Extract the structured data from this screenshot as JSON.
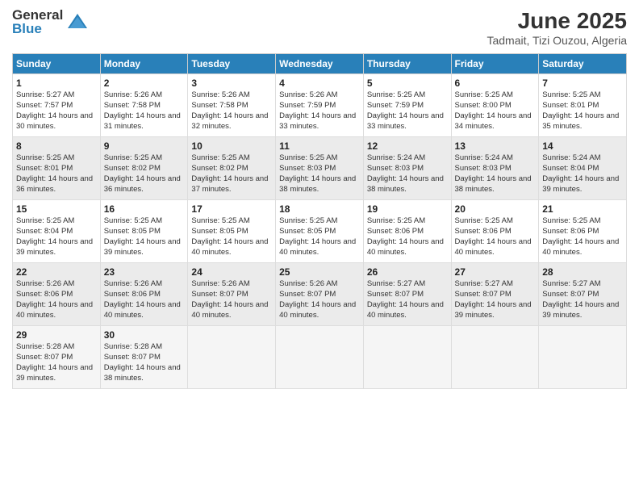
{
  "logo": {
    "general": "General",
    "blue": "Blue"
  },
  "title": "June 2025",
  "subtitle": "Tadmait, Tizi Ouzou, Algeria",
  "headers": [
    "Sunday",
    "Monday",
    "Tuesday",
    "Wednesday",
    "Thursday",
    "Friday",
    "Saturday"
  ],
  "weeks": [
    [
      {
        "num": "1",
        "sunrise": "5:27 AM",
        "sunset": "7:57 PM",
        "daylight": "14 hours and 30 minutes."
      },
      {
        "num": "2",
        "sunrise": "5:26 AM",
        "sunset": "7:58 PM",
        "daylight": "14 hours and 31 minutes."
      },
      {
        "num": "3",
        "sunrise": "5:26 AM",
        "sunset": "7:58 PM",
        "daylight": "14 hours and 32 minutes."
      },
      {
        "num": "4",
        "sunrise": "5:26 AM",
        "sunset": "7:59 PM",
        "daylight": "14 hours and 33 minutes."
      },
      {
        "num": "5",
        "sunrise": "5:25 AM",
        "sunset": "7:59 PM",
        "daylight": "14 hours and 33 minutes."
      },
      {
        "num": "6",
        "sunrise": "5:25 AM",
        "sunset": "8:00 PM",
        "daylight": "14 hours and 34 minutes."
      },
      {
        "num": "7",
        "sunrise": "5:25 AM",
        "sunset": "8:01 PM",
        "daylight": "14 hours and 35 minutes."
      }
    ],
    [
      {
        "num": "8",
        "sunrise": "5:25 AM",
        "sunset": "8:01 PM",
        "daylight": "14 hours and 36 minutes."
      },
      {
        "num": "9",
        "sunrise": "5:25 AM",
        "sunset": "8:02 PM",
        "daylight": "14 hours and 36 minutes."
      },
      {
        "num": "10",
        "sunrise": "5:25 AM",
        "sunset": "8:02 PM",
        "daylight": "14 hours and 37 minutes."
      },
      {
        "num": "11",
        "sunrise": "5:25 AM",
        "sunset": "8:03 PM",
        "daylight": "14 hours and 38 minutes."
      },
      {
        "num": "12",
        "sunrise": "5:24 AM",
        "sunset": "8:03 PM",
        "daylight": "14 hours and 38 minutes."
      },
      {
        "num": "13",
        "sunrise": "5:24 AM",
        "sunset": "8:03 PM",
        "daylight": "14 hours and 38 minutes."
      },
      {
        "num": "14",
        "sunrise": "5:24 AM",
        "sunset": "8:04 PM",
        "daylight": "14 hours and 39 minutes."
      }
    ],
    [
      {
        "num": "15",
        "sunrise": "5:25 AM",
        "sunset": "8:04 PM",
        "daylight": "14 hours and 39 minutes."
      },
      {
        "num": "16",
        "sunrise": "5:25 AM",
        "sunset": "8:05 PM",
        "daylight": "14 hours and 39 minutes."
      },
      {
        "num": "17",
        "sunrise": "5:25 AM",
        "sunset": "8:05 PM",
        "daylight": "14 hours and 40 minutes."
      },
      {
        "num": "18",
        "sunrise": "5:25 AM",
        "sunset": "8:05 PM",
        "daylight": "14 hours and 40 minutes."
      },
      {
        "num": "19",
        "sunrise": "5:25 AM",
        "sunset": "8:06 PM",
        "daylight": "14 hours and 40 minutes."
      },
      {
        "num": "20",
        "sunrise": "5:25 AM",
        "sunset": "8:06 PM",
        "daylight": "14 hours and 40 minutes."
      },
      {
        "num": "21",
        "sunrise": "5:25 AM",
        "sunset": "8:06 PM",
        "daylight": "14 hours and 40 minutes."
      }
    ],
    [
      {
        "num": "22",
        "sunrise": "5:26 AM",
        "sunset": "8:06 PM",
        "daylight": "14 hours and 40 minutes."
      },
      {
        "num": "23",
        "sunrise": "5:26 AM",
        "sunset": "8:06 PM",
        "daylight": "14 hours and 40 minutes."
      },
      {
        "num": "24",
        "sunrise": "5:26 AM",
        "sunset": "8:07 PM",
        "daylight": "14 hours and 40 minutes."
      },
      {
        "num": "25",
        "sunrise": "5:26 AM",
        "sunset": "8:07 PM",
        "daylight": "14 hours and 40 minutes."
      },
      {
        "num": "26",
        "sunrise": "5:27 AM",
        "sunset": "8:07 PM",
        "daylight": "14 hours and 40 minutes."
      },
      {
        "num": "27",
        "sunrise": "5:27 AM",
        "sunset": "8:07 PM",
        "daylight": "14 hours and 39 minutes."
      },
      {
        "num": "28",
        "sunrise": "5:27 AM",
        "sunset": "8:07 PM",
        "daylight": "14 hours and 39 minutes."
      }
    ],
    [
      {
        "num": "29",
        "sunrise": "5:28 AM",
        "sunset": "8:07 PM",
        "daylight": "14 hours and 39 minutes."
      },
      {
        "num": "30",
        "sunrise": "5:28 AM",
        "sunset": "8:07 PM",
        "daylight": "14 hours and 38 minutes."
      },
      null,
      null,
      null,
      null,
      null
    ]
  ],
  "labels": {
    "sunrise": "Sunrise:",
    "sunset": "Sunset:",
    "daylight": "Daylight:"
  }
}
